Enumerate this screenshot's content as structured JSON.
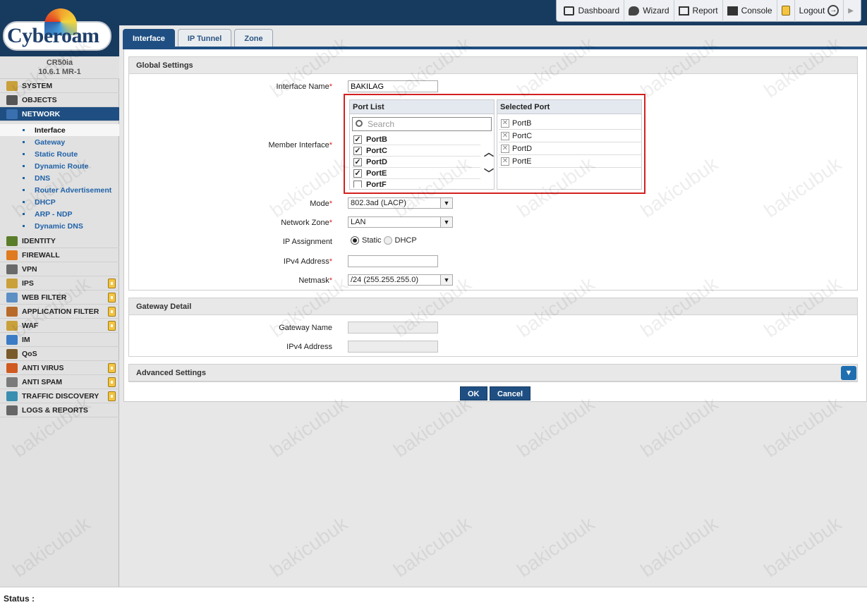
{
  "topmenu": {
    "dashboard": "Dashboard",
    "wizard": "Wizard",
    "report": "Report",
    "console": "Console",
    "logout": "Logout"
  },
  "brand": {
    "logo_text": "Cyberoam",
    "model": "CR50ia",
    "version": "10.6.1 MR-1"
  },
  "sidebar": {
    "items": [
      {
        "label": "SYSTEM",
        "icon": "system-icon",
        "locked": false
      },
      {
        "label": "OBJECTS",
        "icon": "objects-icon",
        "locked": false
      },
      {
        "label": "NETWORK",
        "icon": "network-icon",
        "locked": false,
        "active": true
      },
      {
        "label": "IDENTITY",
        "icon": "identity-icon",
        "locked": false
      },
      {
        "label": "FIREWALL",
        "icon": "firewall-icon",
        "locked": false
      },
      {
        "label": "VPN",
        "icon": "vpn-icon",
        "locked": false
      },
      {
        "label": "IPS",
        "icon": "ips-icon",
        "locked": true
      },
      {
        "label": "WEB FILTER",
        "icon": "web-filter-icon",
        "locked": true
      },
      {
        "label": "APPLICATION FILTER",
        "icon": "app-filter-icon",
        "locked": true
      },
      {
        "label": "WAF",
        "icon": "waf-icon",
        "locked": true
      },
      {
        "label": "IM",
        "icon": "im-icon",
        "locked": false
      },
      {
        "label": "QoS",
        "icon": "qos-icon",
        "locked": false
      },
      {
        "label": "ANTI VIRUS",
        "icon": "anti-virus-icon",
        "locked": true
      },
      {
        "label": "ANTI SPAM",
        "icon": "anti-spam-icon",
        "locked": true
      },
      {
        "label": "TRAFFIC DISCOVERY",
        "icon": "traffic-discovery-icon",
        "locked": true
      },
      {
        "label": "LOGS & REPORTS",
        "icon": "logs-icon",
        "locked": false
      }
    ],
    "network_sub": [
      "Interface",
      "Gateway",
      "Static Route",
      "Dynamic Route",
      "DNS",
      "Router Advertisement",
      "DHCP",
      "ARP - NDP",
      "Dynamic DNS"
    ]
  },
  "tabs": [
    "Interface",
    "IP Tunnel",
    "Zone"
  ],
  "global": {
    "title": "Global Settings",
    "interface_name_label": "Interface Name",
    "interface_name_value": "BAKILAG",
    "member_label": "Member Interface",
    "port_list_header": "Port List",
    "selected_port_header": "Selected Port",
    "search_placeholder": "Search",
    "port_list": [
      "PortB",
      "PortC",
      "PortD",
      "PortE",
      "PortF"
    ],
    "selected_ports": [
      "PortB",
      "PortC",
      "PortD",
      "PortE"
    ],
    "mode_label": "Mode",
    "mode_value": "802.3ad (LACP)",
    "zone_label": "Network Zone",
    "zone_value": "LAN",
    "ip_assign_label": "IP Assignment",
    "static_label": "Static",
    "dhcp_label": "DHCP",
    "ipv4_label": "IPv4 Address",
    "ipv4_value": "",
    "netmask_label": "Netmask",
    "netmask_value": "/24 (255.255.255.0)"
  },
  "gateway": {
    "title": "Gateway Detail",
    "name_label": "Gateway Name",
    "ipv4_label": "IPv4 Address"
  },
  "advanced": {
    "title": "Advanced Settings"
  },
  "buttons": {
    "ok": "OK",
    "cancel": "Cancel"
  },
  "status": {
    "label": "Status :"
  },
  "watermark": "bakicubuk",
  "colors": {
    "header_bg": "#173a5f",
    "accent": "#1f4f82",
    "highlight_border": "#d42020"
  }
}
